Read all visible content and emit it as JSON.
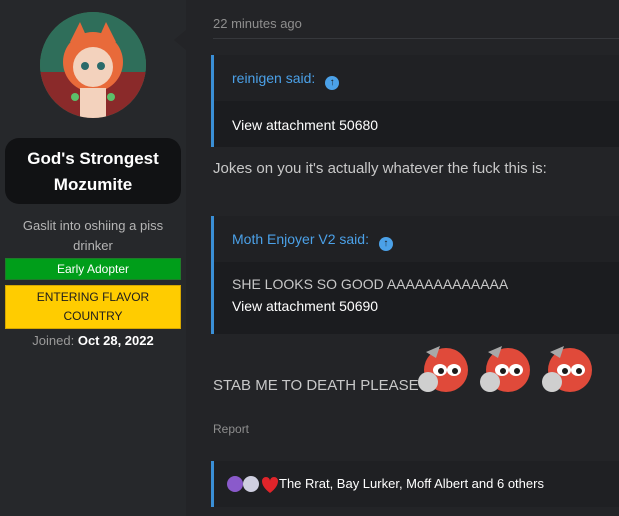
{
  "user": {
    "name_line1": "God's Strongest",
    "name_line2": "Mozumite",
    "title": "Gaslit into oshiing a piss drinker",
    "banner_early": "Early Adopter",
    "banner_flavor": "ENTERING FLAVOR COUNTRY",
    "joined_label": "Joined:",
    "joined_date": "Oct 28, 2022"
  },
  "post": {
    "timestamp": "22 minutes ago",
    "quote1": {
      "author": "reinigen said:",
      "attachment": "View attachment 50680"
    },
    "text1": "Jokes on you it's actually whatever the fuck this is:",
    "quote2": {
      "author": "Moth Enjoyer V2 said:",
      "line": "SHE LOOKS SO GOOD AAAAAAAAAAAAA",
      "attachment": "View attachment 50690"
    },
    "text2": "STAB ME TO DEATH PLEASE",
    "report": "Report",
    "reactions": "The Rrat, Bay Lurker, Moff Albert and 6 others"
  },
  "colors": {
    "accent": "#3a8fd6",
    "banner_green": "#009e1a",
    "banner_yellow": "#ffcc00"
  },
  "icons": [
    "arrow-up-icon",
    "emoji-avatar-icon",
    "reaction-icons"
  ]
}
